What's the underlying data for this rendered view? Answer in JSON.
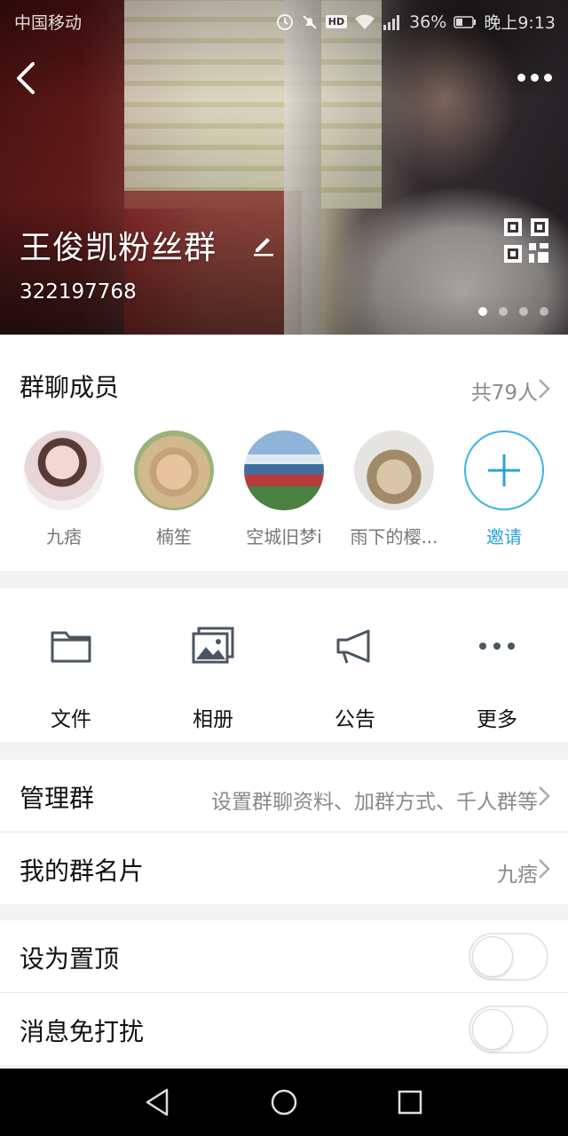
{
  "status_bar": {
    "carrier": "中国移动",
    "battery": "36%",
    "time": "晚上9:13",
    "icons": [
      "alarm-icon",
      "mute-icon",
      "hd-icon",
      "wifi-icon",
      "signal-icon",
      "battery-icon"
    ]
  },
  "header": {
    "group_name": "王俊凯粉丝群",
    "group_id": "322197768",
    "carousel": {
      "total": 4,
      "active": 1
    }
  },
  "members": {
    "title": "群聊成员",
    "count_label": "共79人",
    "items": [
      {
        "name": "九痞"
      },
      {
        "name": "楠笙"
      },
      {
        "name": "空城旧梦i"
      },
      {
        "name": "雨下的樱..."
      }
    ],
    "invite_label": "邀请"
  },
  "actions": [
    {
      "label": "文件",
      "icon": "folder-icon"
    },
    {
      "label": "相册",
      "icon": "album-icon"
    },
    {
      "label": "公告",
      "icon": "megaphone-icon"
    },
    {
      "label": "更多",
      "icon": "more-dots-icon"
    }
  ],
  "settings": {
    "manage": {
      "label": "管理群",
      "value": "设置群聊资料、加群方式、千人群等"
    },
    "my_card": {
      "label": "我的群名片",
      "value": "九痞"
    },
    "pin_top": {
      "label": "设为置顶",
      "on": false
    },
    "mute": {
      "label": "消息免打扰",
      "on": false
    }
  },
  "colors": {
    "accent": "#2aa3db",
    "icon_gray": "#4a5560"
  }
}
